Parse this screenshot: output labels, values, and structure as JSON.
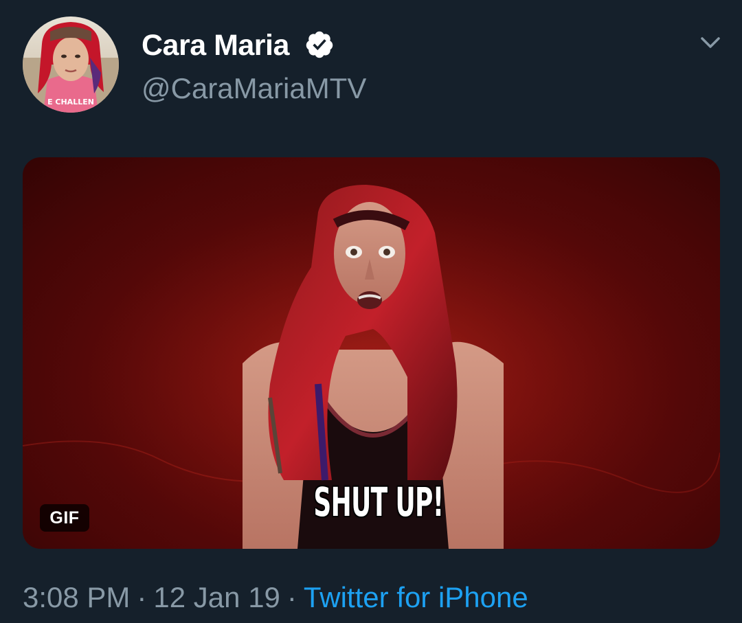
{
  "author": {
    "display_name": "Cara Maria",
    "handle": "@CaraMariaMTV",
    "verified": true,
    "avatar_icon": "profile-photo"
  },
  "media": {
    "type": "gif",
    "badge": "GIF",
    "caption": "SHUT UP!"
  },
  "meta": {
    "time": "3:08 PM",
    "date": "12 Jan 19",
    "separator": "·",
    "source": "Twitter for iPhone"
  },
  "colors": {
    "background": "#15202b",
    "name_text": "#ffffff",
    "secondary_text": "#8899a6",
    "link": "#1da1f2"
  }
}
